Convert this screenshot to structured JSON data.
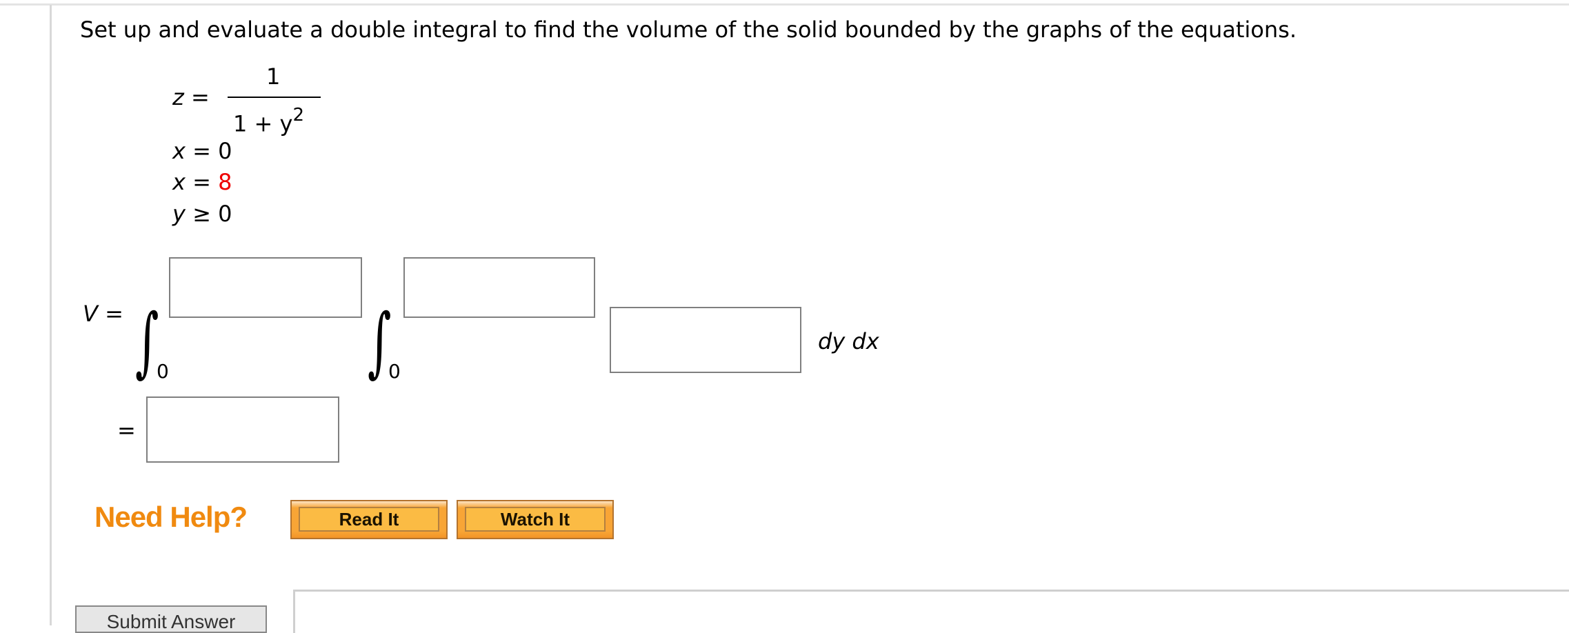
{
  "question": {
    "prompt": "Set up and evaluate a double integral to find the volume of the solid bounded by the graphs of the equations.",
    "equations": {
      "z_lhs": "z =",
      "z_numerator": "1",
      "z_denominator": "1 + y",
      "z_denominator_exp": "2",
      "eq2_lhs": "x = ",
      "eq2_value": "0",
      "eq3_lhs": "x = ",
      "eq3_value": "8",
      "eq4_lhs": "y ≥ ",
      "eq4_value": "0"
    },
    "highlight_color": "#ee0000"
  },
  "answer": {
    "v_label": "V =",
    "outer_lower_limit": "0",
    "inner_lower_limit": "0",
    "outer_upper_value": "",
    "inner_upper_value": "",
    "integrand_value": "",
    "differentials": "dy dx",
    "equals": "=",
    "result_value": ""
  },
  "help": {
    "label": "Need Help?",
    "read_it": "Read It",
    "watch_it": "Watch It",
    "accent_color": "#f08a10"
  },
  "submit": {
    "label": "Submit Answer"
  }
}
